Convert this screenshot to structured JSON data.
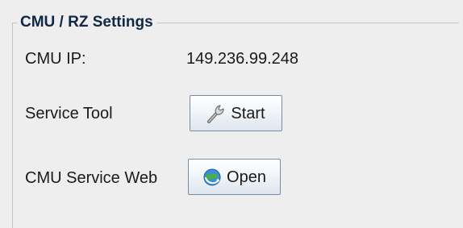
{
  "group": {
    "title": "CMU / RZ Settings"
  },
  "rows": {
    "cmu_ip": {
      "label": "CMU IP:",
      "value": "149.236.99.248"
    },
    "service_tool": {
      "label": "Service Tool",
      "button_label": "Start",
      "icon": "wrench-icon"
    },
    "service_web": {
      "label": "CMU Service Web",
      "button_label": "Open",
      "icon": "browser-globe-icon"
    }
  },
  "colors": {
    "panel_background": "#eeeeee",
    "border": "#c3c3c3",
    "title_text": "#0f2846",
    "button_border": "#7a8ca3"
  }
}
